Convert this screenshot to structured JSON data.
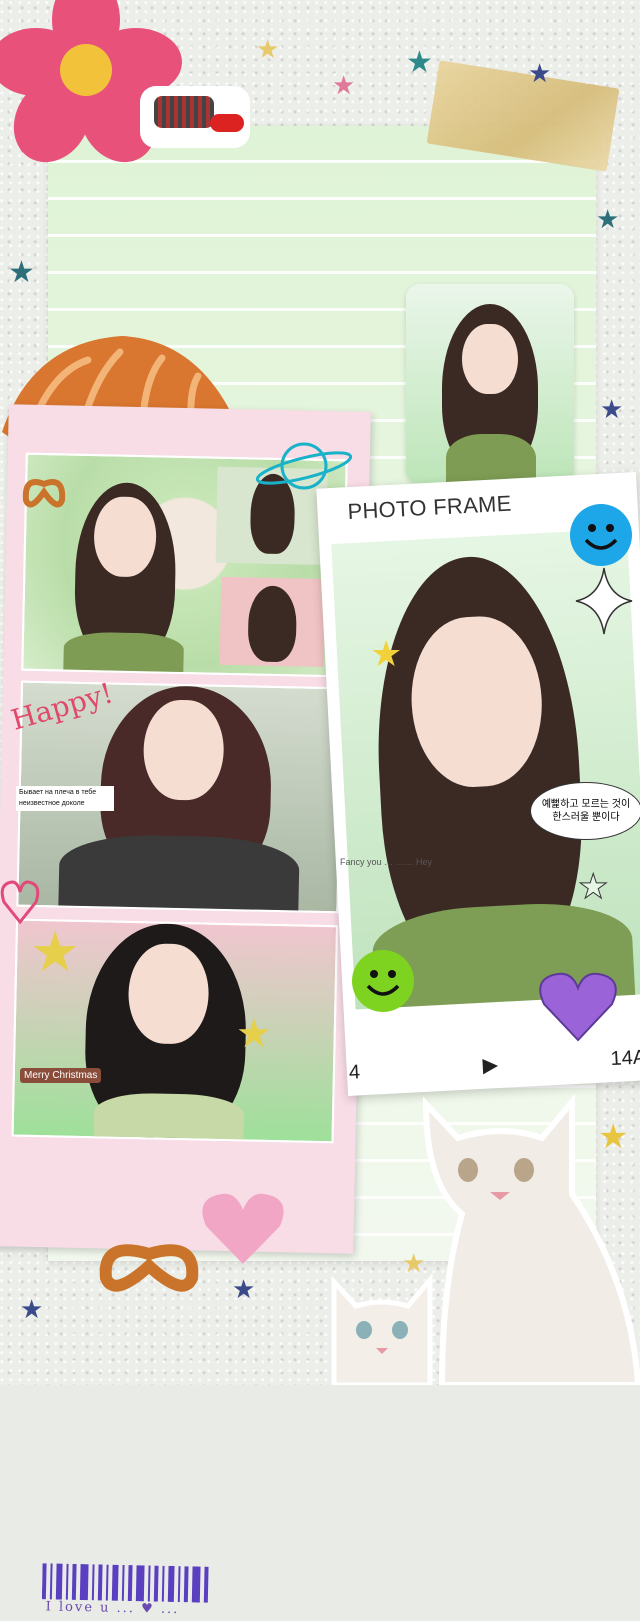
{
  "collage": {
    "photo_frame_title": "PHOTO FRAME",
    "film_left_number": "4",
    "film_right_number": "14A",
    "play_marker": "▶",
    "speech_bubble": "예뻝하고 모르는 것이 한스러울 뿐이다",
    "happy_text": "Happy!",
    "russian_note": "Бывает на плеча в тебе неизвестное доколе",
    "merry_christmas": "Merry Christmas",
    "love_text": "I love u ... ♥ ...",
    "fancy_text": "Fancy you … …… Hey"
  },
  "colors": {
    "notebook": "#dff3d6",
    "strip": "#f8dce6",
    "smiley_blue": "#1ea7e8",
    "smiley_green": "#7ed321",
    "barcode": "#5a3fc0"
  },
  "icons": [
    "flower-icon",
    "croissant-icon",
    "star-icon",
    "smiley-icon",
    "heart-icon",
    "pretzel-icon",
    "sparkle-icon",
    "planet-icon",
    "cat-photo"
  ]
}
